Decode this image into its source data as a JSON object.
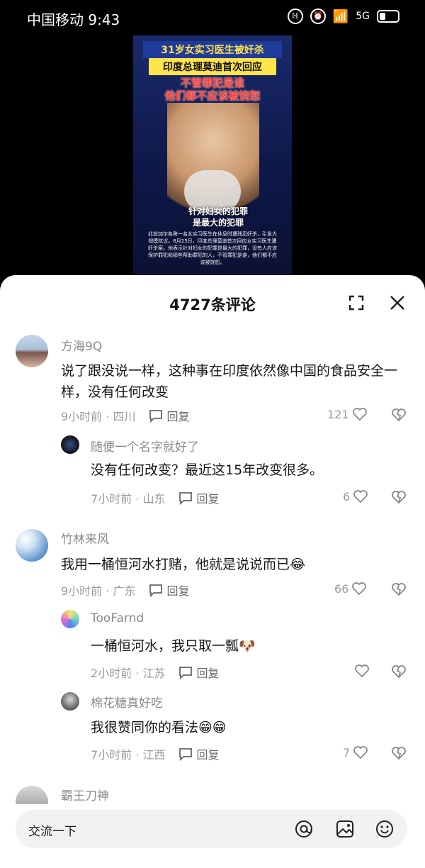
{
  "status_bar": {
    "carrier_time": "中国移动 9:43",
    "network": "5G"
  },
  "video": {
    "caption_line1": "31岁女实习医生被奸杀",
    "caption_line2": "印度总理莫迪首次回应",
    "caption_red_1": "不管罪犯是谁",
    "caption_red_2": "他们都不应该被饶恕",
    "overlay_1": "针对妇女的犯罪",
    "overlay_2": "是最大的犯罪",
    "subtitle": "此前加尔各答一名女实习医生在休息时遭残忍奸杀，引发大规模抗议。8月25日，印度总理莫迪首次回应女实习医生遭奸杀案。他表示针对妇女的犯罪是最大的犯罪，没有人应该保护罪犯和那些帮助罪犯的人，不管罪犯是谁，他们都不应该被饶恕。"
  },
  "comments_header": {
    "title": "4727条评论"
  },
  "comments": [
    {
      "name": "方海9Q",
      "text": "说了跟没说一样，这种事在印度依然像中国的食品安全一样，没有任何改变",
      "meta": "9小时前 · 四川",
      "reply": "回复",
      "likes": "121"
    },
    {
      "name": "随便一个名字就好了",
      "text": "没有任何改变？最近这15年改变很多。",
      "meta": "7小时前 · 山东",
      "reply": "回复",
      "likes": "6"
    },
    {
      "name": "竹林来风",
      "text": "我用一桶恒河水打赌，他就是说说而已😂",
      "meta": "9小时前 · 广东",
      "reply": "回复",
      "likes": "66"
    },
    {
      "name": "TooFarnd",
      "text": "一桶恒河水，我只取一瓢🐶",
      "meta": "2小时前 · 江苏",
      "reply": "回复",
      "likes": ""
    },
    {
      "name": "棉花糖真好吃",
      "text": "我很赞同你的看法😁😁",
      "meta": "7小时前 · 江西",
      "reply": "回复",
      "likes": "7"
    },
    {
      "name": "霸王刀神",
      "text": "",
      "meta": "",
      "reply": "",
      "likes": ""
    }
  ],
  "input": {
    "placeholder": "交流一下"
  },
  "icons": {
    "expand": "expand-icon",
    "close": "close-icon",
    "reply": "reply-bubble-icon",
    "like": "heart-icon",
    "dislike": "broken-heart-icon",
    "at": "at-icon",
    "image": "image-icon",
    "emoji": "emoji-icon"
  }
}
